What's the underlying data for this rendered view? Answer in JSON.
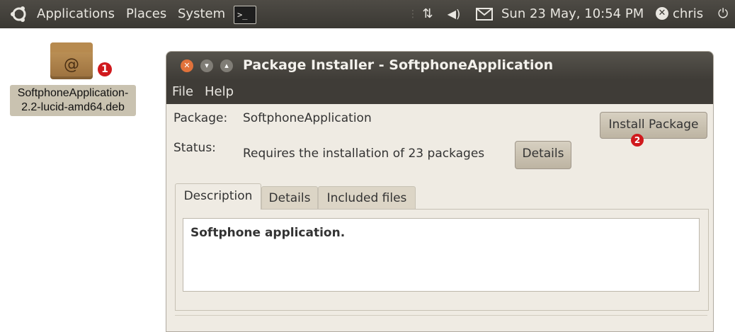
{
  "panel": {
    "menus": {
      "applications": "Applications",
      "places": "Places",
      "system": "System"
    },
    "terminal_glyph": ">_",
    "clock": "Sun 23 May, 10:54 PM",
    "user": "chris"
  },
  "desktop": {
    "file_label": "SoftphoneApplication-2.2-lucid-amd64.deb",
    "badge": "1"
  },
  "window": {
    "title": "Package Installer - SoftphoneApplication",
    "menu": {
      "file": "File",
      "help": "Help"
    },
    "package_label": "Package:",
    "package_value": "SoftphoneApplication",
    "status_label": "Status:",
    "status_value": "Requires the installation of 23 packages",
    "details_button": "Details",
    "install_button": "Install Package",
    "install_badge": "2",
    "tabs": [
      "Description",
      "Details",
      "Included files"
    ],
    "selected_tab": "Description",
    "description_text": "Softphone application."
  },
  "icons": [
    "ubuntu-logo-icon",
    "terminal-icon",
    "network-icon",
    "volume-icon",
    "mail-icon",
    "user-status-icon",
    "power-icon",
    "package-icon",
    "window-close-icon",
    "window-minimize-icon",
    "window-maximize-icon"
  ],
  "colors": {
    "panel": "#3f3c37",
    "accent_close": "#e1723b",
    "badge": "#d0191d",
    "window_bg": "#efebe3"
  }
}
